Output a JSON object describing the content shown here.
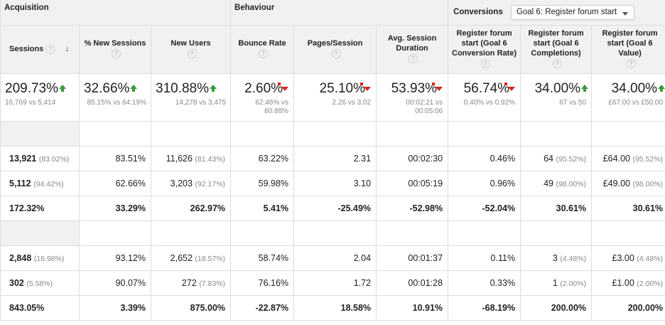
{
  "group_headers": {
    "acquisition": "Acquisition",
    "behaviour": "Behaviour",
    "conversions": "Conversions",
    "goal_select": "Goal 6: Register forum start"
  },
  "columns": [
    {
      "label": "Sessions",
      "help": "?",
      "sort": "↓"
    },
    {
      "label": "% New Sessions",
      "help": "?"
    },
    {
      "label": "New Users",
      "help": "?"
    },
    {
      "label": "Bounce Rate",
      "help": "?"
    },
    {
      "label": "Pages/Session",
      "help": "?"
    },
    {
      "label": "Avg. Session Duration",
      "help": "?"
    },
    {
      "label": "Register forum start (Goal 6 Conversion Rate)",
      "help": "?"
    },
    {
      "label": "Register forum start (Goal 6 Completions)",
      "help": "?"
    },
    {
      "label": "Register forum start (Goal 6 Value)",
      "help": "?"
    }
  ],
  "summary": [
    {
      "value": "209.73%",
      "trend": "up",
      "sub": "16,769 vs 5,414"
    },
    {
      "value": "32.66%",
      "trend": "up",
      "sub": "85.15% vs 64.19%"
    },
    {
      "value": "310.88%",
      "trend": "up",
      "sub": "14,278 vs 3,475"
    },
    {
      "value": "2.60%",
      "trend": "down",
      "sub": "62.46% vs 60.88%"
    },
    {
      "value": "25.10%",
      "trend": "down",
      "sub": "2.26 vs 3.02"
    },
    {
      "value": "53.93%",
      "trend": "down",
      "sub": "00:02:21 vs 00:05:06"
    },
    {
      "value": "56.74%",
      "trend": "down",
      "sub": "0.40% vs 0.92%"
    },
    {
      "value": "34.00%",
      "trend": "up",
      "sub": "67 vs 50"
    },
    {
      "value": "34.00%",
      "trend": "up",
      "sub": "£67.00 vs £50.00"
    }
  ],
  "rows": [
    {
      "type": "blank"
    },
    {
      "type": "data",
      "cells": [
        {
          "v": "13,921",
          "p": "(83.02%)"
        },
        {
          "v": "83.51%"
        },
        {
          "v": "11,626",
          "p": "(81.43%)"
        },
        {
          "v": "63.22%"
        },
        {
          "v": "2.31"
        },
        {
          "v": "00:02:30"
        },
        {
          "v": "0.46%"
        },
        {
          "v": "64",
          "p": "(95.52%)"
        },
        {
          "v": "£64.00",
          "p": "(95.52%)"
        }
      ]
    },
    {
      "type": "data",
      "cells": [
        {
          "v": "5,112",
          "p": "(94.42%)"
        },
        {
          "v": "62.66%"
        },
        {
          "v": "3,203",
          "p": "(92.17%)"
        },
        {
          "v": "59.98%"
        },
        {
          "v": "3.10"
        },
        {
          "v": "00:05:19"
        },
        {
          "v": "0.96%"
        },
        {
          "v": "49",
          "p": "(98.00%)"
        },
        {
          "v": "£49.00",
          "p": "(98.00%)"
        }
      ]
    },
    {
      "type": "bold",
      "cells": [
        {
          "v": "172.32%"
        },
        {
          "v": "33.29%"
        },
        {
          "v": "262.97%"
        },
        {
          "v": "5.41%"
        },
        {
          "v": "-25.49%"
        },
        {
          "v": "-52.98%"
        },
        {
          "v": "-52.04%"
        },
        {
          "v": "30.61%"
        },
        {
          "v": "30.61%"
        }
      ]
    },
    {
      "type": "blank"
    },
    {
      "type": "data",
      "cells": [
        {
          "v": "2,848",
          "p": "(16.98%)"
        },
        {
          "v": "93.12%"
        },
        {
          "v": "2,652",
          "p": "(18.57%)"
        },
        {
          "v": "58.74%"
        },
        {
          "v": "2.04"
        },
        {
          "v": "00:01:37"
        },
        {
          "v": "0.11%"
        },
        {
          "v": "3",
          "p": "(4.48%)"
        },
        {
          "v": "£3.00",
          "p": "(4.48%)"
        }
      ]
    },
    {
      "type": "data",
      "cells": [
        {
          "v": "302",
          "p": "(5.58%)"
        },
        {
          "v": "90.07%"
        },
        {
          "v": "272",
          "p": "(7.83%)"
        },
        {
          "v": "76.16%"
        },
        {
          "v": "1.72"
        },
        {
          "v": "00:01:28"
        },
        {
          "v": "0.33%"
        },
        {
          "v": "1",
          "p": "(2.00%)"
        },
        {
          "v": "£1.00",
          "p": "(2.00%)"
        }
      ]
    },
    {
      "type": "bold",
      "cells": [
        {
          "v": "843.05%"
        },
        {
          "v": "3.39%"
        },
        {
          "v": "875.00%"
        },
        {
          "v": "-22.87%"
        },
        {
          "v": "18.58%"
        },
        {
          "v": "10.91%"
        },
        {
          "v": "-68.19%"
        },
        {
          "v": "200.00%"
        },
        {
          "v": "200.00%"
        }
      ]
    }
  ],
  "colors": {
    "up": "#3a9a3a",
    "down": "#e02020",
    "header_bg": "#f1f1f1",
    "border": "#dddddd"
  }
}
